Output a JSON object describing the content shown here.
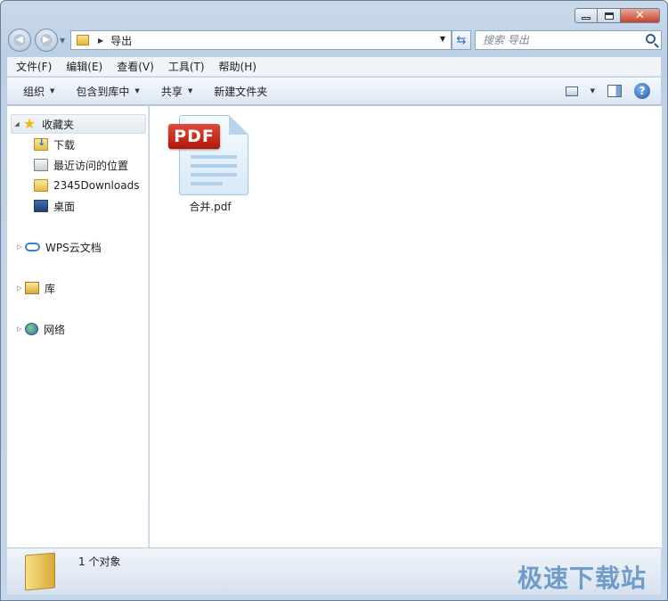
{
  "window": {
    "caption": {
      "minimize": "",
      "maximize": "",
      "close": "✕"
    }
  },
  "navigation": {
    "back_icon": "back-arrow-icon",
    "forward_icon": "forward-arrow-icon",
    "address": {
      "path": "导出"
    },
    "search": {
      "placeholder": "搜索 导出"
    }
  },
  "menubar": {
    "items": [
      {
        "label": "文件(F)"
      },
      {
        "label": "编辑(E)"
      },
      {
        "label": "查看(V)"
      },
      {
        "label": "工具(T)"
      },
      {
        "label": "帮助(H)"
      }
    ]
  },
  "toolbar": {
    "organize": "组织",
    "include_in_library": "包含到库中",
    "share": "共享",
    "new_folder": "新建文件夹",
    "help": "?"
  },
  "nav_pane": {
    "favorites": {
      "label": "收藏夹"
    },
    "favorites_items": [
      {
        "label": "下载",
        "icon": "download-folder-icon"
      },
      {
        "label": "最近访问的位置",
        "icon": "recent-places-icon"
      },
      {
        "label": "2345Downloads",
        "icon": "folder-icon"
      },
      {
        "label": "桌面",
        "icon": "desktop-icon"
      }
    ],
    "wps": {
      "label": "WPS云文档"
    },
    "library": {
      "label": "库"
    },
    "network": {
      "label": "网络"
    }
  },
  "content": {
    "files": [
      {
        "name": "合并.pdf",
        "badge": "PDF",
        "icon": "pdf-file-icon"
      }
    ]
  },
  "statusbar": {
    "count": "1 个对象",
    "watermark": "极速下载站"
  }
}
